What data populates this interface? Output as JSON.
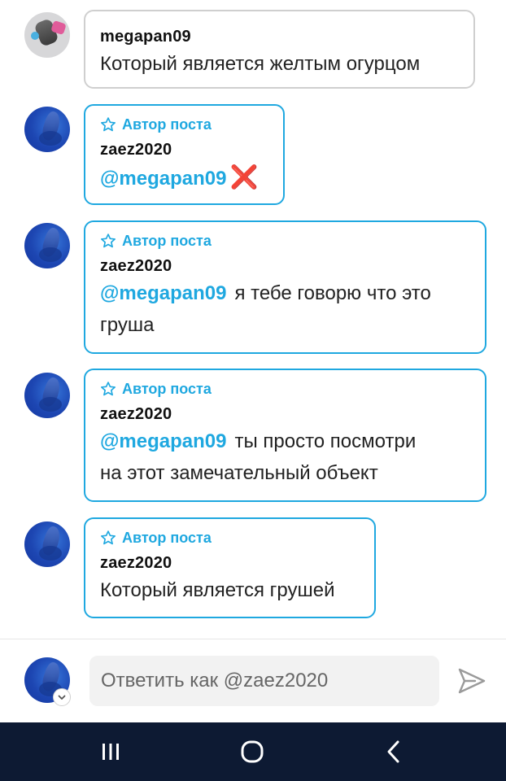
{
  "author_tag": "Автор поста",
  "comments": [
    {
      "username": "megapan09",
      "text": "Который является желтым огурцом"
    },
    {
      "username": "zaez2020",
      "mention": "@megapan09",
      "text": ""
    },
    {
      "username": "zaez2020",
      "mention": "@megapan09",
      "text_line1": "я тебе говорю что это",
      "text_line2": "груша"
    },
    {
      "username": "zaez2020",
      "mention": "@megapan09",
      "text_line1": "ты просто посмотри",
      "text_line2": "на этот замечательный объект"
    },
    {
      "username": "zaez2020",
      "text": "Который является грушей"
    }
  ],
  "reply": {
    "placeholder": "Ответить как @zaez2020"
  },
  "icons": {
    "star": "star-outline-icon",
    "cross": "red-cross-mark-icon",
    "send": "send-arrow-icon",
    "nav_recent": "recent-apps-icon",
    "nav_home": "home-icon",
    "nav_back": "back-icon"
  },
  "colors": {
    "accent": "#1fa8e0",
    "cross": "#e0262f",
    "navbar": "#0d1a33"
  }
}
